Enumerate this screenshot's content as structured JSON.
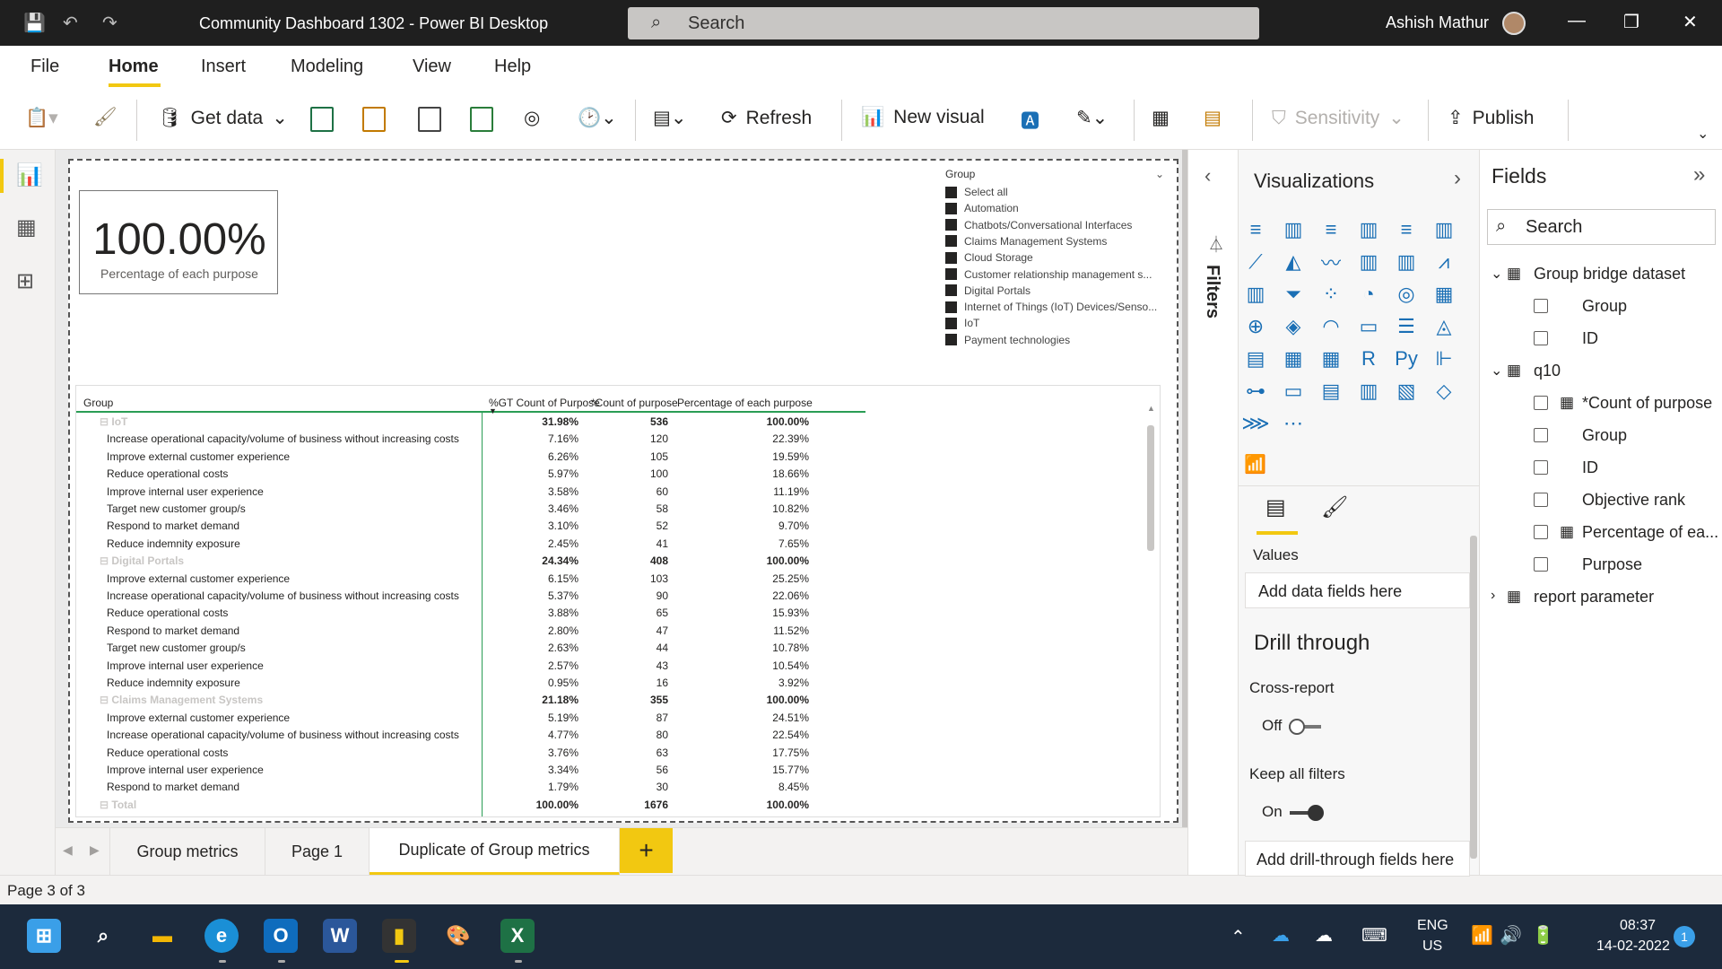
{
  "titlebar": {
    "title": "Community Dashboard 1302 - Power BI Desktop",
    "search": "Search",
    "user": "Ashish Mathur"
  },
  "menu_tabs": [
    "File",
    "Home",
    "Insert",
    "Modeling",
    "View",
    "Help"
  ],
  "ribbon": {
    "get_data": "Get data",
    "refresh": "Refresh",
    "new_visual": "New visual",
    "sensitivity": "Sensitivity",
    "publish": "Publish"
  },
  "card": {
    "value": "100.00%",
    "label": "Percentage of each purpose"
  },
  "slicer": {
    "title": "Group",
    "items": [
      "Select all",
      "Automation",
      "Chatbots/Conversational Interfaces",
      "Claims Management Systems",
      "Cloud Storage",
      "Customer relationship management s...",
      "Digital Portals",
      "Internet of Things (IoT) Devices/Senso...",
      "IoT",
      "Payment technologies"
    ]
  },
  "matrix": {
    "headers": [
      "Group",
      "%GT Count of Purpose",
      "*Count of purpose",
      "Percentage of each purpose"
    ],
    "rows": [
      {
        "type": "group",
        "label": "IoT",
        "gt": "31.98%",
        "count": "536",
        "pct": "100.00%"
      },
      {
        "type": "item",
        "label": "Increase operational capacity/volume of business without increasing costs",
        "gt": "7.16%",
        "count": "120",
        "pct": "22.39%"
      },
      {
        "type": "item",
        "label": "Improve external customer experience",
        "gt": "6.26%",
        "count": "105",
        "pct": "19.59%"
      },
      {
        "type": "item",
        "label": "Reduce operational costs",
        "gt": "5.97%",
        "count": "100",
        "pct": "18.66%"
      },
      {
        "type": "item",
        "label": "Improve internal user experience",
        "gt": "3.58%",
        "count": "60",
        "pct": "11.19%"
      },
      {
        "type": "item",
        "label": "Target new customer group/s",
        "gt": "3.46%",
        "count": "58",
        "pct": "10.82%"
      },
      {
        "type": "item",
        "label": "Respond to market demand",
        "gt": "3.10%",
        "count": "52",
        "pct": "9.70%"
      },
      {
        "type": "item",
        "label": "Reduce indemnity exposure",
        "gt": "2.45%",
        "count": "41",
        "pct": "7.65%"
      },
      {
        "type": "group",
        "label": "Digital Portals",
        "gt": "24.34%",
        "count": "408",
        "pct": "100.00%"
      },
      {
        "type": "item",
        "label": "Improve external customer experience",
        "gt": "6.15%",
        "count": "103",
        "pct": "25.25%"
      },
      {
        "type": "item",
        "label": "Increase operational capacity/volume of business without increasing costs",
        "gt": "5.37%",
        "count": "90",
        "pct": "22.06%"
      },
      {
        "type": "item",
        "label": "Reduce operational costs",
        "gt": "3.88%",
        "count": "65",
        "pct": "15.93%"
      },
      {
        "type": "item",
        "label": "Respond to market demand",
        "gt": "2.80%",
        "count": "47",
        "pct": "11.52%"
      },
      {
        "type": "item",
        "label": "Target new customer group/s",
        "gt": "2.63%",
        "count": "44",
        "pct": "10.78%"
      },
      {
        "type": "item",
        "label": "Improve internal user experience",
        "gt": "2.57%",
        "count": "43",
        "pct": "10.54%"
      },
      {
        "type": "item",
        "label": "Reduce indemnity exposure",
        "gt": "0.95%",
        "count": "16",
        "pct": "3.92%"
      },
      {
        "type": "group",
        "label": "Claims Management Systems",
        "gt": "21.18%",
        "count": "355",
        "pct": "100.00%"
      },
      {
        "type": "item",
        "label": "Improve external customer experience",
        "gt": "5.19%",
        "count": "87",
        "pct": "24.51%"
      },
      {
        "type": "item",
        "label": "Increase operational capacity/volume of business without increasing costs",
        "gt": "4.77%",
        "count": "80",
        "pct": "22.54%"
      },
      {
        "type": "item",
        "label": "Reduce operational costs",
        "gt": "3.76%",
        "count": "63",
        "pct": "17.75%"
      },
      {
        "type": "item",
        "label": "Improve internal user experience",
        "gt": "3.34%",
        "count": "56",
        "pct": "15.77%"
      },
      {
        "type": "item",
        "label": "Respond to market demand",
        "gt": "1.79%",
        "count": "30",
        "pct": "8.45%"
      },
      {
        "type": "group",
        "label": "Total",
        "gt": "100.00%",
        "count": "1676",
        "pct": "100.00%"
      }
    ]
  },
  "page_tabs": [
    "Group metrics",
    "Page 1",
    "Duplicate of Group metrics"
  ],
  "add_page": "+",
  "status": "Page 3 of 3",
  "filters_label": "Filters",
  "viz": {
    "title": "Visualizations",
    "values_label": "Values",
    "add_fields": "Add data fields here",
    "drill_title": "Drill through",
    "cross_report": "Cross-report",
    "cross_state": "Off",
    "keep_filters": "Keep all filters",
    "keep_state": "On",
    "add_drill": "Add drill-through fields here"
  },
  "fields": {
    "title": "Fields",
    "search": "Search",
    "tables": [
      {
        "name": "Group bridge dataset",
        "expanded": true,
        "fields": [
          "Group",
          "ID"
        ]
      },
      {
        "name": "q10",
        "expanded": true,
        "fields": [
          "*Count of purpose",
          "Group",
          "ID",
          "Objective rank",
          "Percentage of ea...",
          "Purpose"
        ]
      },
      {
        "name": "report parameter",
        "expanded": false,
        "fields": []
      }
    ]
  },
  "taskbar": {
    "lang1": "ENG",
    "lang2": "US",
    "time": "08:37",
    "date": "14-02-2022",
    "badge": "1"
  }
}
